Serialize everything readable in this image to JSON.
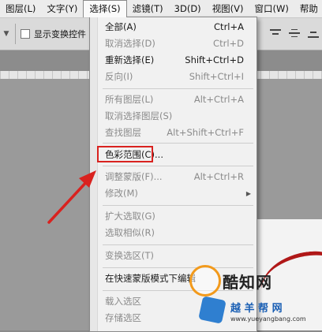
{
  "menubar": {
    "items": [
      {
        "label": "图层(L)"
      },
      {
        "label": "文字(Y)"
      },
      {
        "label": "选择(S)"
      },
      {
        "label": "滤镜(T)"
      },
      {
        "label": "3D(D)"
      },
      {
        "label": "视图(V)"
      },
      {
        "label": "窗口(W)"
      },
      {
        "label": "帮助"
      }
    ]
  },
  "options_bar": {
    "checkbox_label": "显示变换控件"
  },
  "select_menu": {
    "items": [
      {
        "label": "全部(A)",
        "shortcut": "Ctrl+A",
        "disabled": false
      },
      {
        "label": "取消选择(D)",
        "shortcut": "Ctrl+D",
        "disabled": true
      },
      {
        "label": "重新选择(E)",
        "shortcut": "Shift+Ctrl+D",
        "disabled": false
      },
      {
        "label": "反向(I)",
        "shortcut": "Shift+Ctrl+I",
        "disabled": true
      },
      {
        "label": "所有图层(L)",
        "shortcut": "Alt+Ctrl+A",
        "disabled": true
      },
      {
        "label": "取消选择图层(S)",
        "shortcut": "",
        "disabled": true
      },
      {
        "label": "查找图层",
        "shortcut": "Alt+Shift+Ctrl+F",
        "disabled": true
      },
      {
        "label": "色彩范围(C)...",
        "shortcut": "",
        "disabled": false
      },
      {
        "label": "调整蒙版(F)...",
        "shortcut": "Alt+Ctrl+R",
        "disabled": true
      },
      {
        "label": "修改(M)",
        "shortcut": "",
        "disabled": true
      },
      {
        "label": "扩大选取(G)",
        "shortcut": "",
        "disabled": true
      },
      {
        "label": "选取相似(R)",
        "shortcut": "",
        "disabled": true
      },
      {
        "label": "变换选区(T)",
        "shortcut": "",
        "disabled": true
      },
      {
        "label": "在快速蒙版模式下编辑",
        "shortcut": "",
        "disabled": false
      },
      {
        "label": "载入选区",
        "shortcut": "",
        "disabled": true
      },
      {
        "label": "存储选区",
        "shortcut": "",
        "disabled": true
      }
    ]
  },
  "watermark": {
    "line1": "酷知网",
    "line2": "越 羊 帮 网",
    "line3": "www.yueyangbang.com"
  },
  "colors": {
    "highlight": "#d9221f",
    "arrow": "#d9221f"
  }
}
